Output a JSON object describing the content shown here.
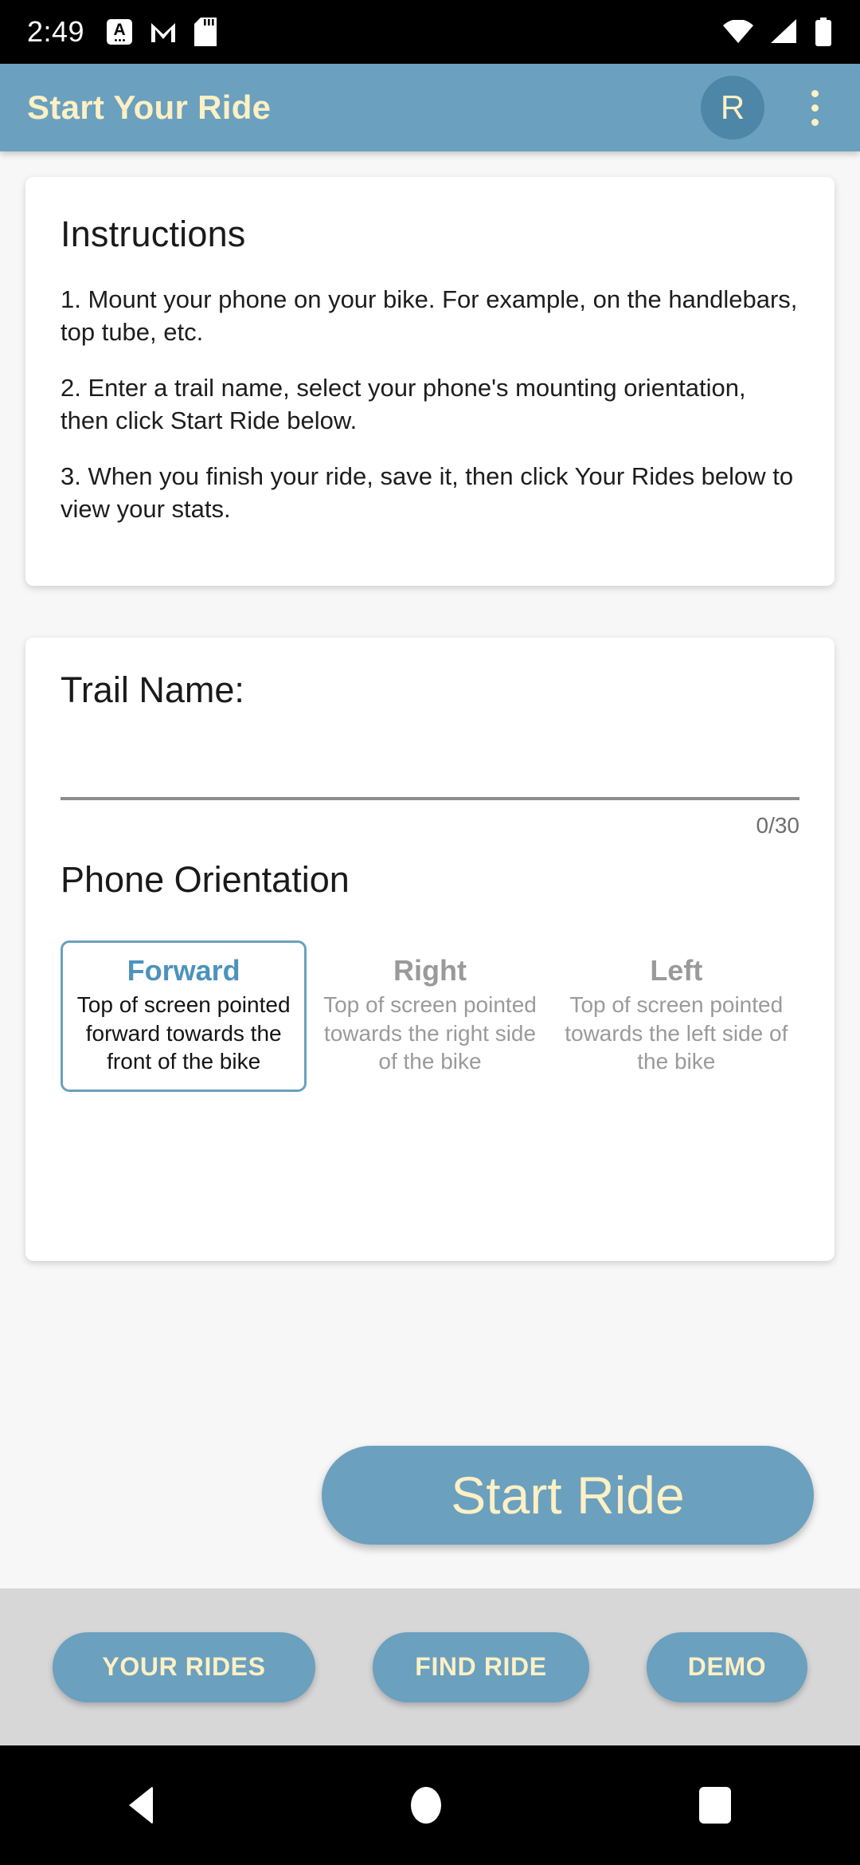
{
  "status_bar": {
    "clock": "2:49",
    "left_icons": [
      "app-notification-icon",
      "gmail-icon",
      "sd-card-icon"
    ],
    "right_icons": [
      "wifi-icon",
      "cellular-signal-icon",
      "battery-icon"
    ]
  },
  "app_bar": {
    "title": "Start Your Ride",
    "avatar_initial": "R",
    "overflow_menu": "overflow-menu-icon",
    "background_color": "#6ba0bf",
    "text_color": "#fdf0c4"
  },
  "instructions_card": {
    "heading": "Instructions",
    "items": [
      "1. Mount your phone on your bike. For example, on the handlebars, top tube, etc.",
      " 2. Enter a trail name, select your phone's mounting orientation, then click Start Ride below.",
      " 3. When you finish your ride, save it, then click Your Rides below to view your stats."
    ]
  },
  "form_card": {
    "trail_name_label": "Trail Name:",
    "trail_name_value": "",
    "trail_name_placeholder": "",
    "char_counter": "0/30",
    "orientation_heading": "Phone Orientation",
    "orientation_options": [
      {
        "title": "Forward",
        "description": "Top of screen pointed forward towards the front of the bike",
        "selected": true
      },
      {
        "title": "Right",
        "description": "Top of screen pointed towards the right side of the bike",
        "selected": false
      },
      {
        "title": "Left",
        "description": "Top of screen pointed towards the left side of the bike",
        "selected": false
      }
    ]
  },
  "primary_action": {
    "label": "Start Ride"
  },
  "bottom_bar": {
    "buttons": [
      {
        "label": "YOUR  RIDES"
      },
      {
        "label": "FIND RIDE"
      },
      {
        "label": "DEMO"
      }
    ]
  },
  "nav_bar": {
    "back": "back-triangle-icon",
    "home": "home-circle-icon",
    "recents": "recents-square-icon"
  },
  "colors": {
    "accent": "#6ba0bf",
    "accent_dark": "#4d86a7",
    "cream": "#fdf0c4",
    "page_background": "#f7f7f7",
    "bottom_bar_background": "#d7d7d7",
    "muted_text": "#9a9a9a",
    "selected_title": "#4d92bd"
  }
}
